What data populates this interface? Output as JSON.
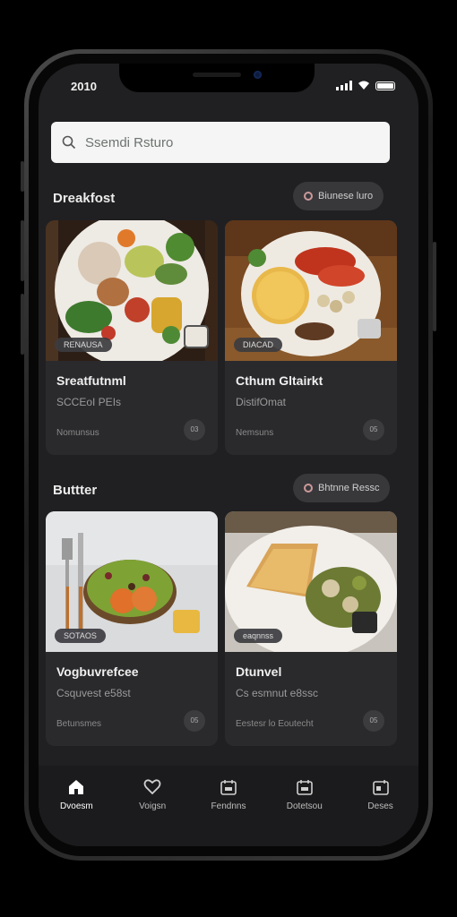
{
  "status_bar": {
    "time": "2010"
  },
  "search": {
    "placeholder": "Ssemdi Rsturo"
  },
  "sections": [
    {
      "title": "Dreakfost",
      "action_label": "Biunese luro",
      "cards": [
        {
          "tag": "RENAUSA",
          "name": "Sreatfutnml",
          "desc": "SCCEoI PEIs",
          "meta": "Nomunsus",
          "action": "03"
        },
        {
          "tag": "DIACAD",
          "name": "Cthum Gltairkt",
          "desc": "DistifOmat",
          "meta": "Nemsuns",
          "action": "05"
        }
      ]
    },
    {
      "title": "Buttter",
      "action_label": "Bhtnne Ressc",
      "cards": [
        {
          "tag": "SOTAOS",
          "name": "Vogbuvrefcee",
          "desc": "Csquvest e58st",
          "meta": "Betunsmes",
          "action": "05"
        },
        {
          "tag": "eaqnnss",
          "name": "Dtunvel",
          "desc": "Cs esmnut e8ssc",
          "meta": "Eestesr lo Eoutecht",
          "action": "05"
        }
      ]
    }
  ],
  "tabs": [
    {
      "label": "Dvoesm",
      "icon": "home-icon",
      "active": true
    },
    {
      "label": "Voigsn",
      "icon": "heart-icon",
      "active": false
    },
    {
      "label": "Fendnns",
      "icon": "calendar-icon",
      "active": false
    },
    {
      "label": "Dotetsou",
      "icon": "calendar-icon",
      "active": false
    },
    {
      "label": "Deses",
      "icon": "calendar-icon",
      "active": false
    }
  ]
}
